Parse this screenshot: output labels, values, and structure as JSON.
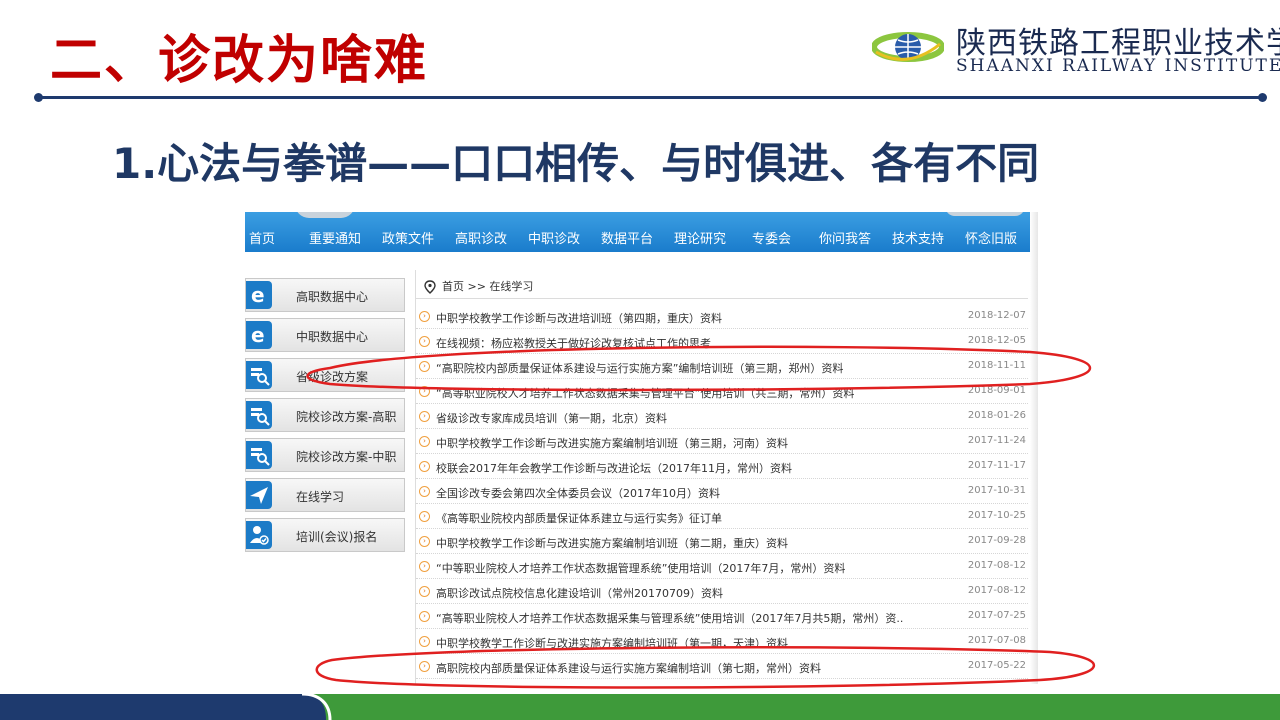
{
  "slide": {
    "title": "二、诊改为啥难",
    "subtitle": "1.心法与拳谱——口口相传、与时俱进、各有不同"
  },
  "logo": {
    "name_cn": "陕西铁路工程职业技术学院",
    "name_en": "SHAANXI RAILWAY INSTITUTE"
  },
  "nav": {
    "items": [
      "首页",
      "重要通知",
      "政策文件",
      "高职诊改",
      "中职诊改",
      "数据平台",
      "理论研究",
      "专委会",
      "你问我答",
      "技术支持",
      "怀念旧版"
    ]
  },
  "sidebar": {
    "items": [
      {
        "label": "高职数据中心",
        "icon": "e-icon"
      },
      {
        "label": "中职数据中心",
        "icon": "e-icon"
      },
      {
        "label": "省级诊改方案",
        "icon": "search-doc-icon"
      },
      {
        "label": "院校诊改方案-高职",
        "icon": "search-doc-icon"
      },
      {
        "label": "院校诊改方案-中职",
        "icon": "search-doc-icon"
      },
      {
        "label": "在线学习",
        "icon": "send-icon"
      },
      {
        "label": "培训(会议)报名",
        "icon": "user-check-icon"
      }
    ]
  },
  "breadcrumb": "首页 >> 在线学习",
  "list": [
    {
      "title": "中职学校教学工作诊断与改进培训班（第四期，重庆）资料",
      "date": "2018-12-07"
    },
    {
      "title": "在线视频：杨应崧教授关于做好诊改复核试点工作的思考",
      "date": "2018-12-05"
    },
    {
      "title": "“高职院校内部质量保证体系建设与运行实施方案”编制培训班（第三期，郑州）资料",
      "date": "2018-11-11"
    },
    {
      "title": "“高等职业院校人才培养工作状态数据采集与管理平台”使用培训（共三期，常州）资料",
      "date": "2018-09-01"
    },
    {
      "title": "省级诊改专家库成员培训（第一期，北京）资料",
      "date": "2018-01-26"
    },
    {
      "title": "中职学校教学工作诊断与改进实施方案编制培训班（第三期，河南）资料",
      "date": "2017-11-24"
    },
    {
      "title": "校联会2017年年会教学工作诊断与改进论坛（2017年11月，常州）资料",
      "date": "2017-11-17"
    },
    {
      "title": "全国诊改专委会第四次全体委员会议（2017年10月）资料",
      "date": "2017-10-31"
    },
    {
      "title": "《高等职业院校内部质量保证体系建立与运行实务》征订单",
      "date": "2017-10-25"
    },
    {
      "title": "中职学校教学工作诊断与改进实施方案编制培训班（第二期，重庆）资料",
      "date": "2017-09-28"
    },
    {
      "title": "“中等职业院校人才培养工作状态数据管理系统”使用培训（2017年7月，常州）资料",
      "date": "2017-08-12"
    },
    {
      "title": "高职诊改试点院校信息化建设培训（常州20170709）资料",
      "date": "2017-08-12"
    },
    {
      "title": "“高等职业院校人才培养工作状态数据采集与管理系统”使用培训（2017年7月共5期，常州）资..",
      "date": "2017-07-25"
    },
    {
      "title": "中职学校教学工作诊断与改进实施方案编制培训班（第一期，天津）资料",
      "date": "2017-07-08"
    },
    {
      "title": "高职院校内部质量保证体系建设与运行实施方案编制培训（第七期，常州）资料",
      "date": "2017-05-22"
    }
  ],
  "colors": {
    "title_red": "#c00000",
    "subtitle_navy": "#1f3864",
    "nav_blue": "#1a7ccc",
    "annotation_red": "#e02020",
    "footer_navy": "#1e3a6e",
    "footer_green": "#3e9a3a"
  }
}
